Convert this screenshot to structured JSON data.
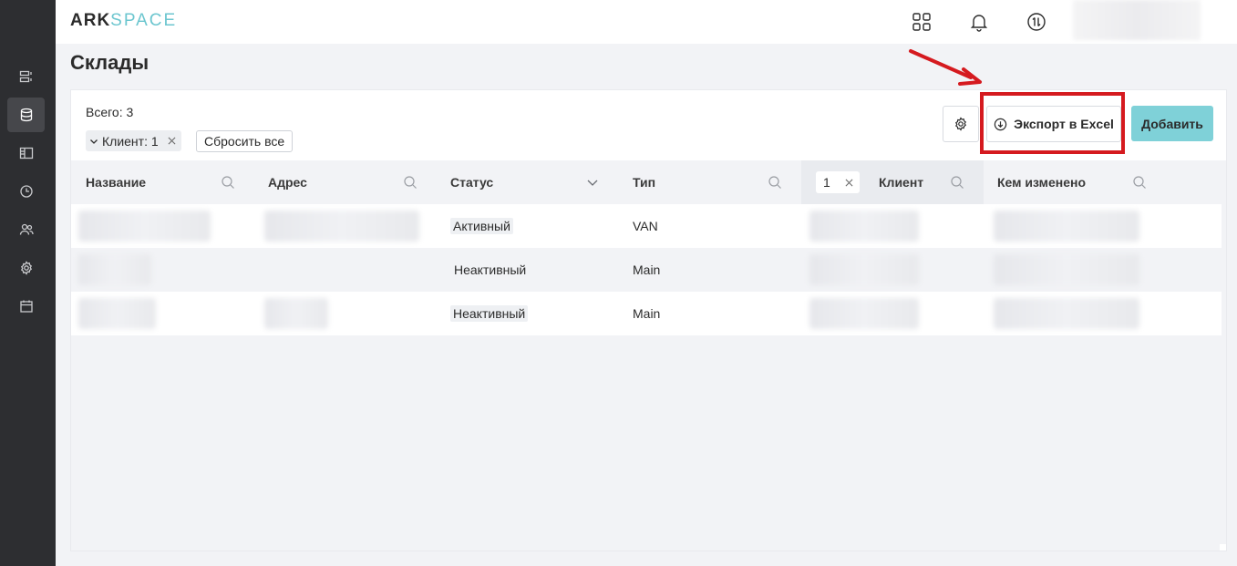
{
  "header": {
    "logo_ark": "ARK",
    "logo_space": "SPACE"
  },
  "sidebar": {
    "items": [
      {
        "icon": "list-icon",
        "active": false
      },
      {
        "icon": "database-icon",
        "active": true
      },
      {
        "icon": "layout-icon",
        "active": false
      },
      {
        "icon": "clock-icon",
        "active": false
      },
      {
        "icon": "users-icon",
        "active": false
      },
      {
        "icon": "gear-icon",
        "active": false
      },
      {
        "icon": "calendar-icon",
        "active": false
      }
    ]
  },
  "page": {
    "title": "Склады"
  },
  "toolbar": {
    "total": "Всего: 3",
    "filter_chip": "Клиент: 1",
    "reset_label": "Сбросить все",
    "export_label": "Экспорт в Excel",
    "add_label": "Добавить"
  },
  "table": {
    "columns": [
      "Название",
      "Адрес",
      "Статус",
      "Тип",
      "Клиент",
      "Кем изменено"
    ],
    "client_filter_value": "1",
    "rows": [
      {
        "status": "Активный",
        "type": "VAN"
      },
      {
        "status": "Неактивный",
        "type": "Main"
      },
      {
        "status": "Неактивный",
        "type": "Main"
      }
    ]
  },
  "colors": {
    "sidebar": "#2d2e31",
    "accent": "#7fd1d8",
    "highlight": "#d51a1f",
    "logo_space": "#6cc6cf"
  }
}
